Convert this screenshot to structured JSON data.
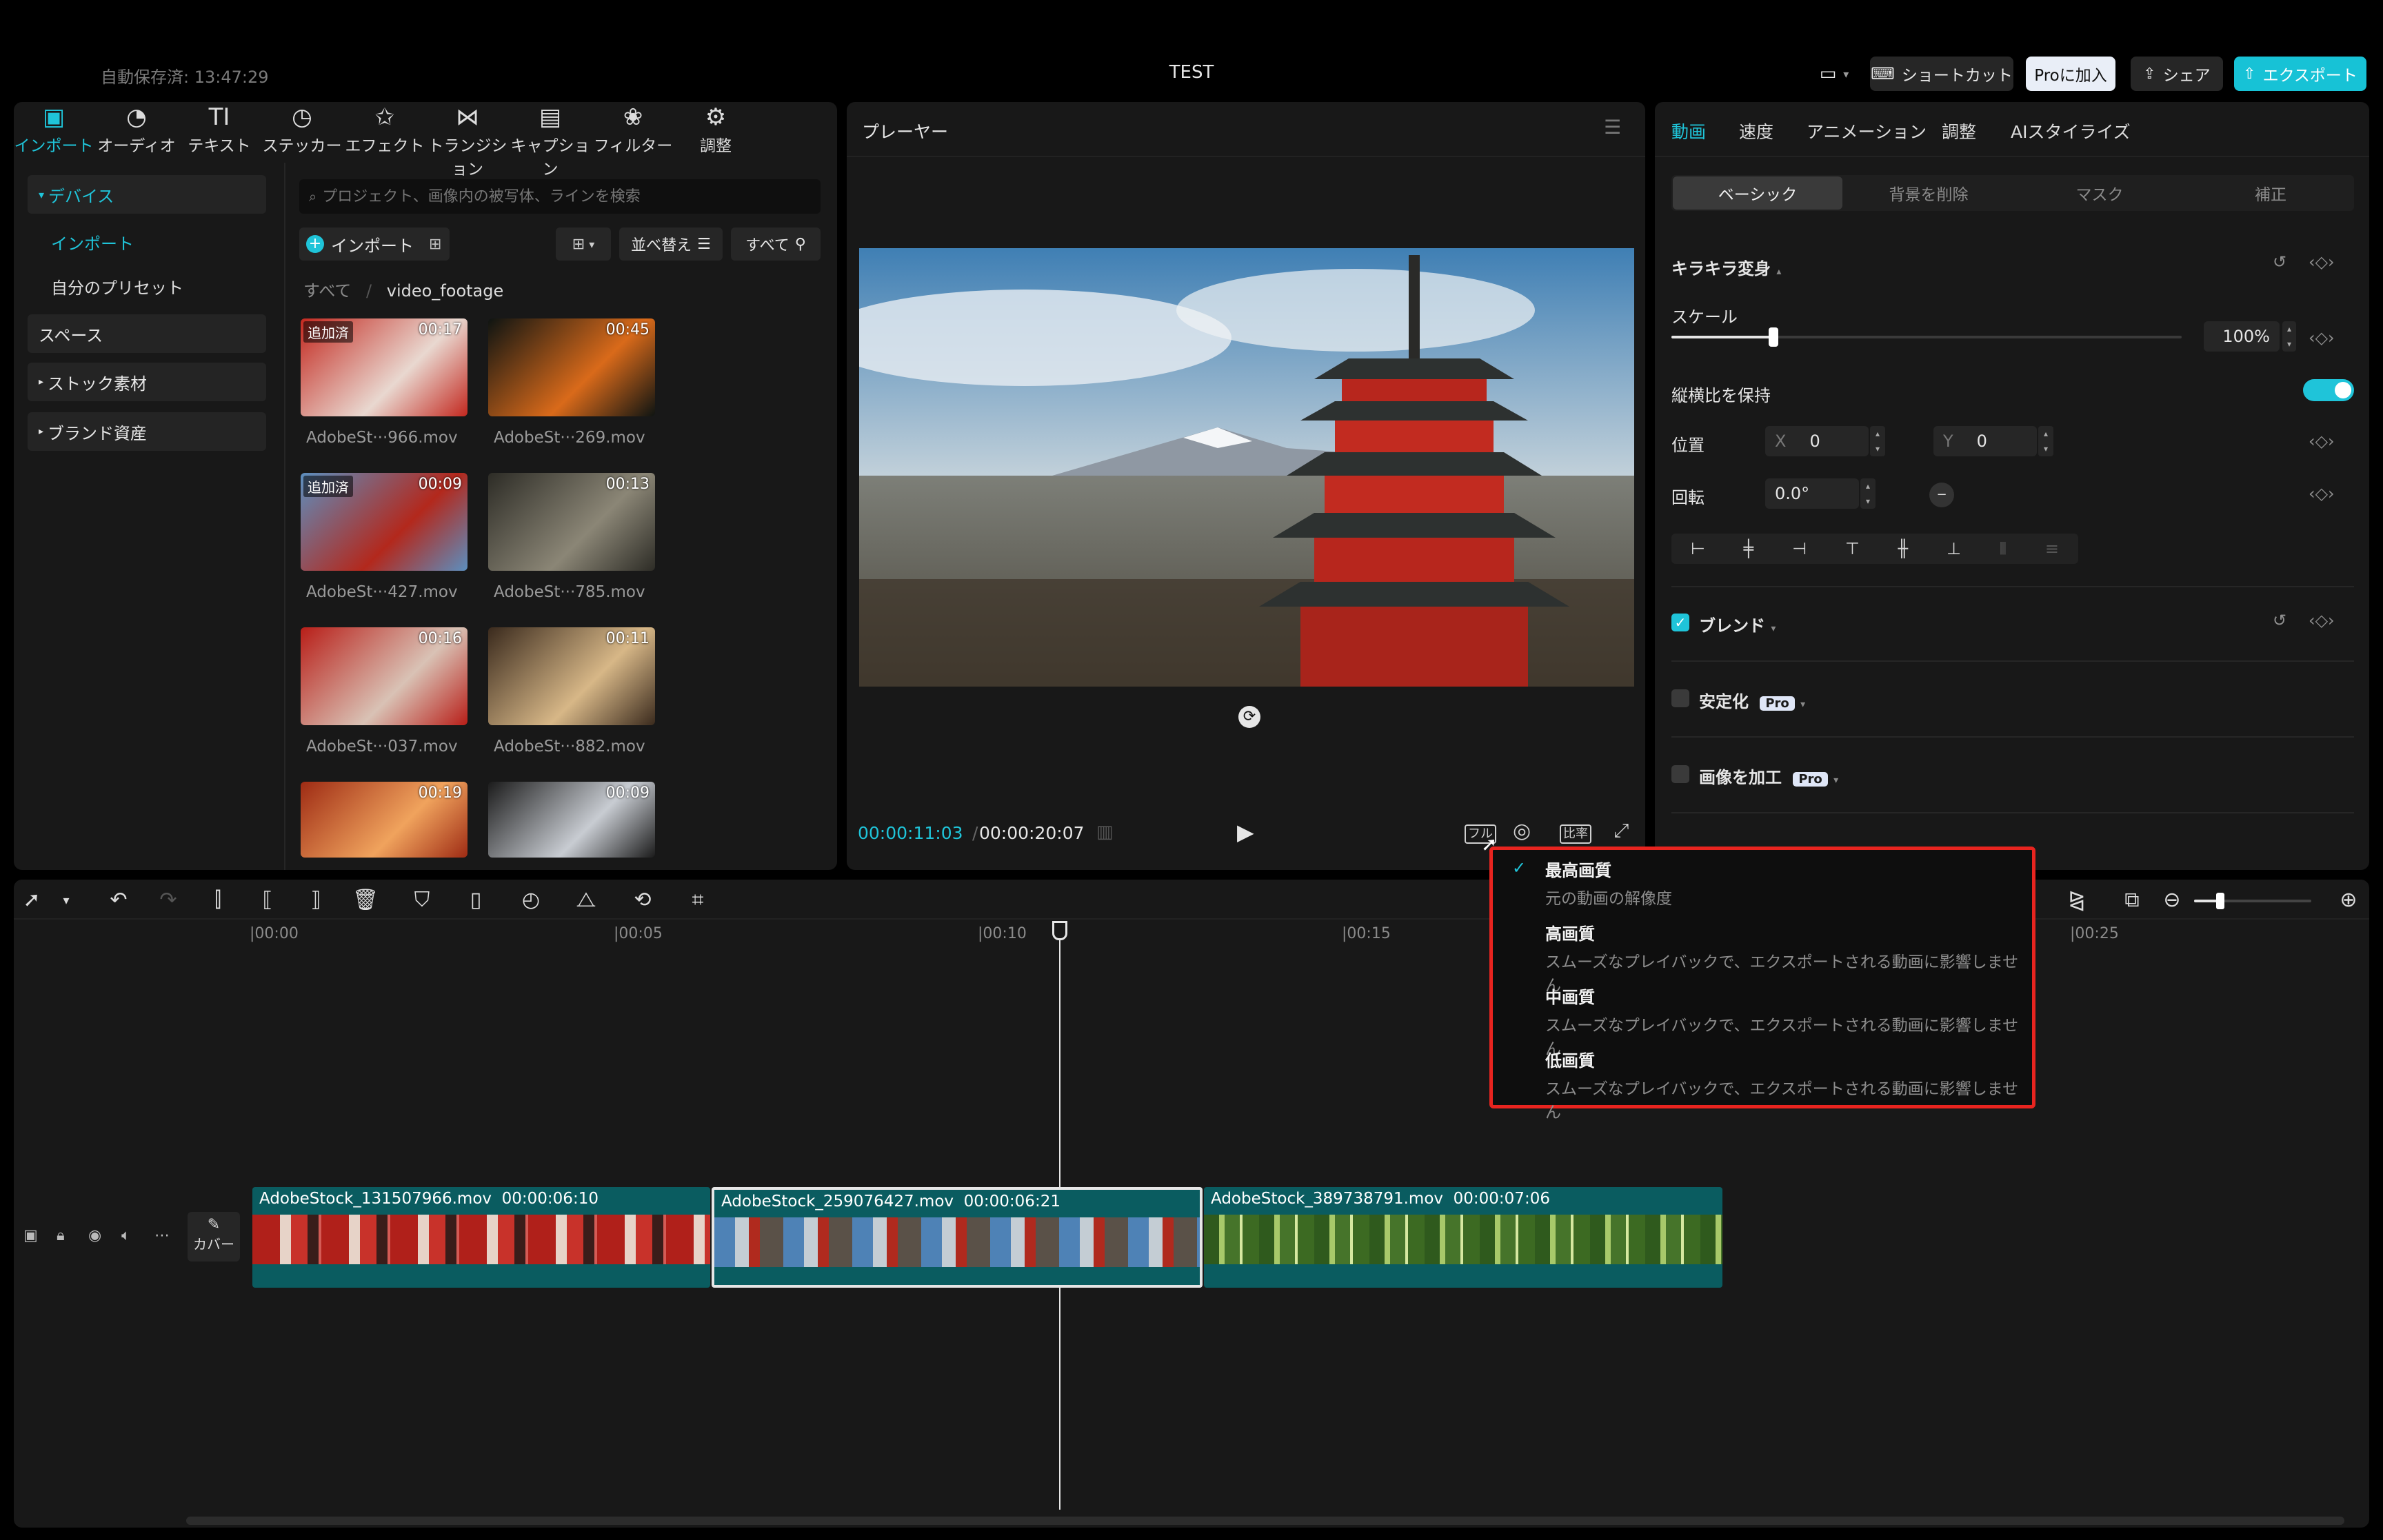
{
  "header": {
    "autosave": "自動保存済: 13:47:29",
    "title": "TEST",
    "shortcut_label": "ショートカット",
    "pro_label": "Proに加入",
    "share_label": "シェア",
    "export_label": "エクスポート"
  },
  "media_toolbar": [
    {
      "label": "インポート",
      "icon": "▣"
    },
    {
      "label": "オーディオ",
      "icon": "◔"
    },
    {
      "label": "テキスト",
      "icon": "TI"
    },
    {
      "label": "ステッカー",
      "icon": "◷"
    },
    {
      "label": "エフェクト",
      "icon": "✩"
    },
    {
      "label": "トランジション",
      "icon": "⋈"
    },
    {
      "label": "キャプション",
      "icon": "▤"
    },
    {
      "label": "フィルター",
      "icon": "❀"
    },
    {
      "label": "調整",
      "icon": "⚙"
    }
  ],
  "sidebar": {
    "device": "デバイス",
    "import": "インポート",
    "presets": "自分のプリセット",
    "space": "スペース",
    "stock": "ストック素材",
    "brand": "ブランド資産"
  },
  "media": {
    "search_placeholder": "プロジェクト、画像内の被写体、ラインを検索",
    "import_btn": "インポート",
    "sort_btn": "並べ替え",
    "filter_btn": "すべて",
    "crumb_all": "すべて",
    "crumb_folder": "video_footage",
    "added_label": "追加済",
    "items": [
      {
        "name": "AdobeSt···966.mov",
        "dur": "00:17",
        "added": true
      },
      {
        "name": "AdobeSt···269.mov",
        "dur": "00:45",
        "added": false
      },
      {
        "name": "AdobeSt···427.mov",
        "dur": "00:09",
        "added": true
      },
      {
        "name": "AdobeSt···785.mov",
        "dur": "00:13",
        "added": false
      },
      {
        "name": "AdobeSt···037.mov",
        "dur": "00:16",
        "added": false
      },
      {
        "name": "AdobeSt···882.mov",
        "dur": "00:11",
        "added": false
      },
      {
        "name": "",
        "dur": "00:19",
        "added": false
      },
      {
        "name": "",
        "dur": "00:09",
        "added": false
      }
    ]
  },
  "player": {
    "title": "プレーヤー",
    "current_time": "00:00:11:03",
    "total_time": "00:00:20:07",
    "quality_btn": "フル",
    "ratio_btn": "比率"
  },
  "inspector": {
    "tabs": [
      "動画",
      "速度",
      "アニメーション",
      "調整",
      "AIスタイライズ"
    ],
    "segments": [
      "ベーシック",
      "背景を削除",
      "マスク",
      "補正"
    ],
    "transform_label": "キラキラ変身",
    "scale_label": "スケール",
    "scale_value": "100%",
    "scale_level": 0.2,
    "aspect_label": "縦横比を保持",
    "position_label": "位置",
    "pos_x_label": "X",
    "pos_x": "0",
    "pos_y_label": "Y",
    "pos_y": "0",
    "rotation_label": "回転",
    "rotation_value": "0.0°",
    "blend_label": "ブレンド",
    "stabilize_label": "安定化",
    "enhance_label": "画像を加工",
    "pro_badge": "Pro"
  },
  "timeline": {
    "ruler": [
      "|00:00",
      "|00:05",
      "|00:10",
      "|00:15",
      "|00:25"
    ],
    "cover_label": "カバー",
    "clips": [
      {
        "name": "AdobeStock_131507966.mov",
        "duration": "00:00:06:10"
      },
      {
        "name": "AdobeStock_259076427.mov",
        "duration": "00:00:06:21"
      },
      {
        "name": "AdobeStock_389738791.mov",
        "duration": "00:00:07:06"
      }
    ]
  },
  "quality_menu": [
    {
      "title": "最高画質",
      "desc": "元の動画の解像度",
      "selected": true
    },
    {
      "title": "高画質",
      "desc": "スムーズなプレイバックで、エクスポートされる動画に影響しません",
      "selected": false
    },
    {
      "title": "中画質",
      "desc": "スムーズなプレイバックで、エクスポートされる動画に影響しません",
      "selected": false
    },
    {
      "title": "低画質",
      "desc": "スムーズなプレイバックで、エクスポートされる動画に影響しません",
      "selected": false
    }
  ],
  "colors": {
    "accent": "#1fc4d9",
    "highlight": "#e8241f",
    "clip": "#0a5c60"
  }
}
